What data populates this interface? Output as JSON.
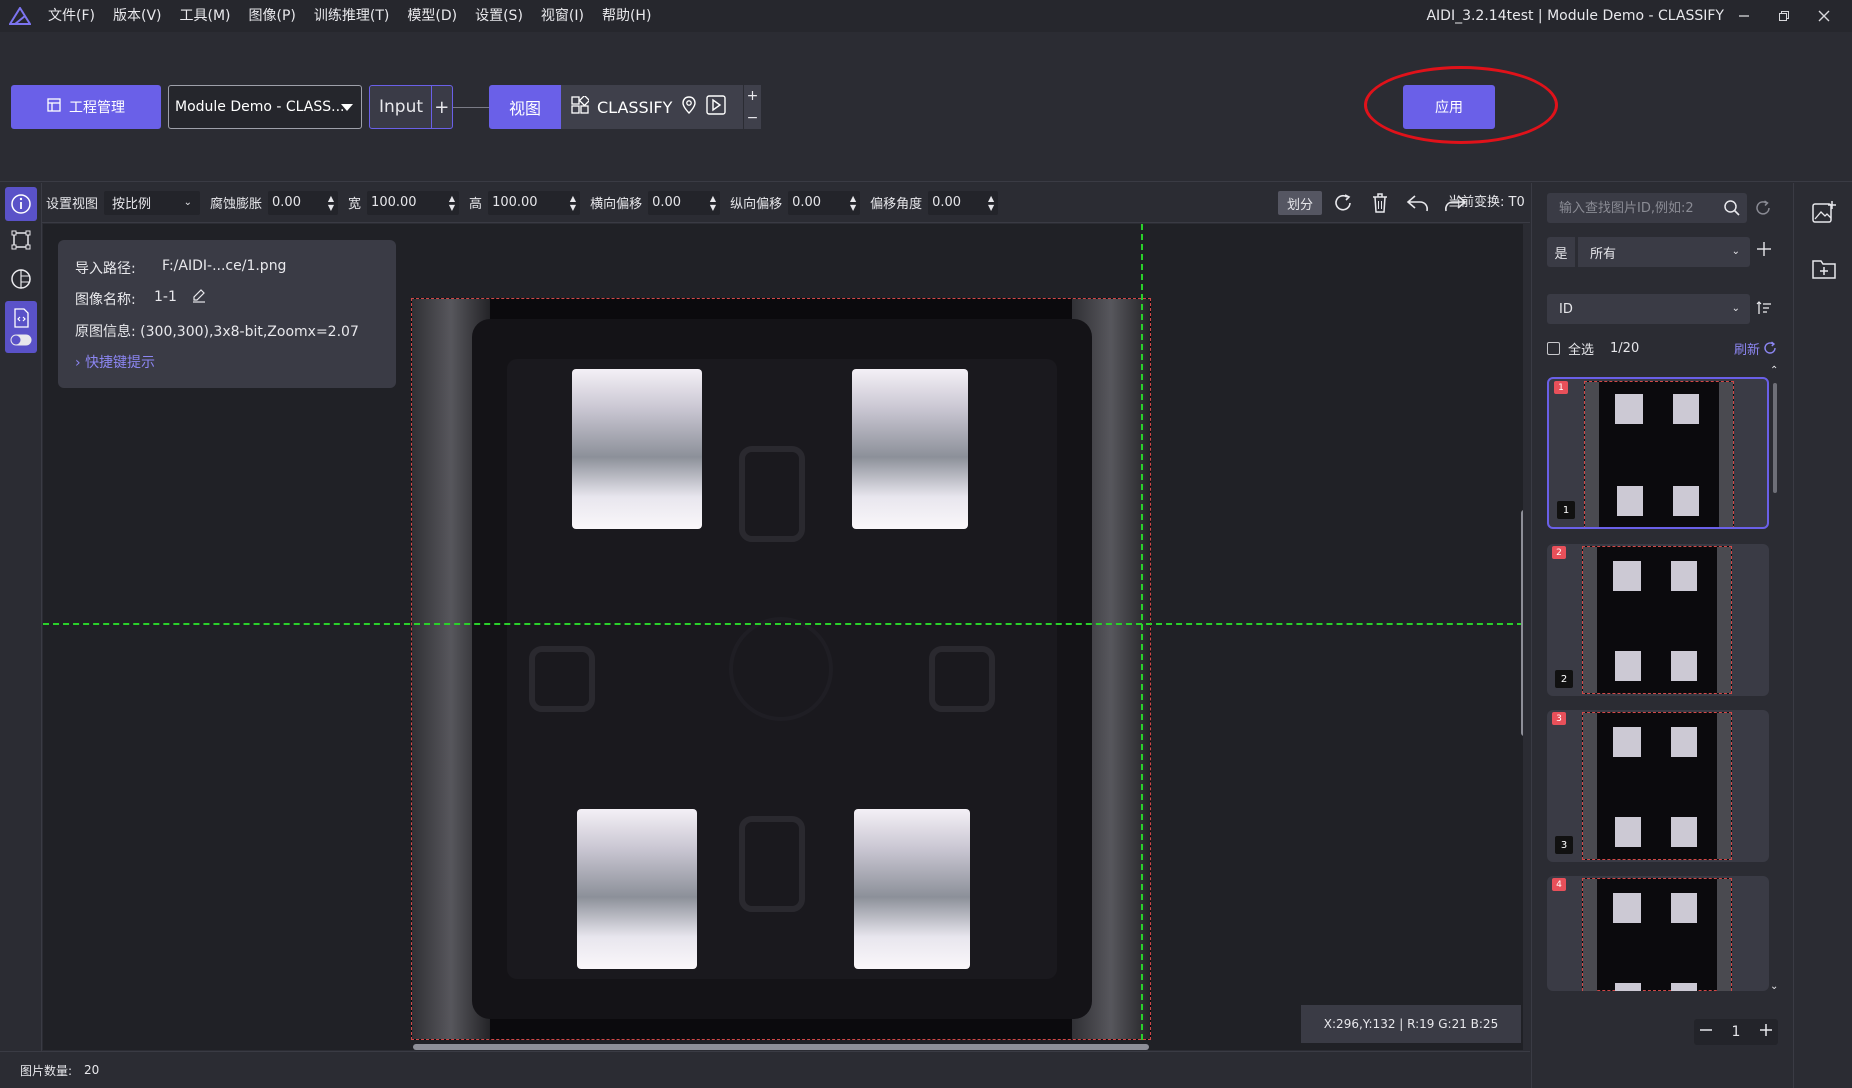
{
  "menu": {
    "items": [
      "文件(F)",
      "版本(V)",
      "工具(M)",
      "图像(P)",
      "训练推理(T)",
      "模型(D)",
      "设置(S)",
      "视窗(I)",
      "帮助(H)"
    ],
    "window_title": "AIDI_3.2.14test | Module Demo - CLASSIFY"
  },
  "pipeline": {
    "project_button": "工程管理",
    "project_select": "Module Demo - CLASS...",
    "input_node": "Input",
    "input_add": "+",
    "view_node": "视图",
    "classify_node": "CLASSIFY",
    "zoom_in": "+",
    "zoom_out": "−",
    "apply_button": "应用"
  },
  "toolbar": {
    "set_view_label": "设置视图",
    "scale_mode": "按比例",
    "erode_label": "腐蚀膨胀",
    "erode_value": "0.00",
    "width_label": "宽",
    "width_value": "100.00",
    "height_label": "高",
    "height_value": "100.00",
    "h_offset_label": "横向偏移",
    "h_offset_value": "0.00",
    "v_offset_label": "纵向偏移",
    "v_offset_value": "0.00",
    "angle_label": "偏移角度",
    "angle_value": "0.00",
    "split_button": "划分",
    "current_transform": "当前变换: T0"
  },
  "info_panel": {
    "path_label": "导入路径:",
    "path_value": "F:/AIDI-...ce/1.png",
    "name_label": "图像名称:",
    "name_value": "1-1",
    "source_info": "原图信息: (300,300),3x8-bit,Zoomx=2.07",
    "shortcut_link": "快捷键提示"
  },
  "canvas": {
    "coord_readout": "X:296,Y:132  |  R:19 G:21 B:25"
  },
  "statusbar": {
    "count_label": "图片数量:",
    "count_value": "20"
  },
  "gallery": {
    "search_placeholder": "输入查找图片ID,例如:2",
    "filter_prefix": "是",
    "filter_value": "所有",
    "sort_value": "ID",
    "select_all_label": "全选",
    "selection_count": "1/20",
    "refresh_label": "刷新",
    "thumbnails": [
      {
        "flag": "1",
        "number": "1"
      },
      {
        "flag": "2",
        "number": "2"
      },
      {
        "flag": "3",
        "number": "3"
      },
      {
        "flag": "4",
        "number": ""
      }
    ],
    "page": "1"
  },
  "colors": {
    "accent": "#6a60e8",
    "guide": "#2ad12a",
    "highlight": "#e0121a",
    "frame": "#d04848"
  }
}
